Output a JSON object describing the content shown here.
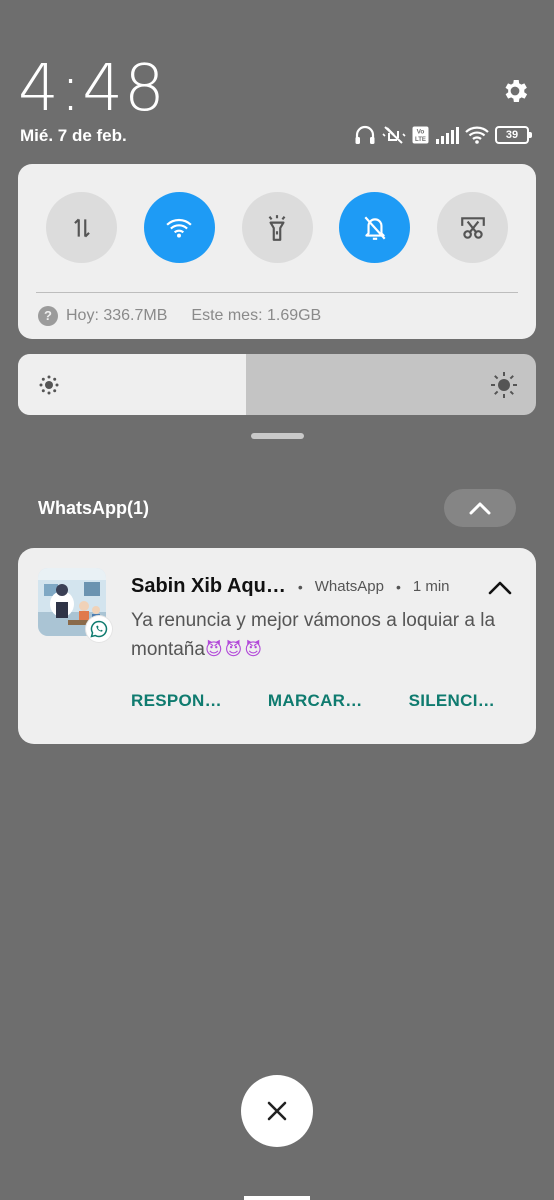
{
  "status": {
    "time": "4:48",
    "date": "Mié. 7 de feb.",
    "battery": "39",
    "volte": "Vo LTE",
    "icons": [
      "headphones-icon",
      "mute-vibrate-icon",
      "volte-icon",
      "signal-icon",
      "wifi-icon",
      "battery-icon"
    ]
  },
  "settings_icon": "gear-icon",
  "quick_settings": {
    "tiles": [
      {
        "name": "mobile-data",
        "icon": "data-arrows-icon",
        "active": false
      },
      {
        "name": "wifi",
        "icon": "wifi-icon",
        "active": true
      },
      {
        "name": "flashlight",
        "icon": "flashlight-icon",
        "active": false
      },
      {
        "name": "silent",
        "icon": "bell-off-icon",
        "active": true
      },
      {
        "name": "screenshot",
        "icon": "scissors-icon",
        "active": false
      }
    ],
    "usage_today": "Hoy: 336.7MB",
    "usage_month": "Este mes: 1.69GB"
  },
  "brightness": {
    "level": 0.44
  },
  "group": {
    "title": "WhatsApp(1)"
  },
  "notification": {
    "sender": "Sabin Xib Aqu…",
    "app": "WhatsApp",
    "time": "1 min",
    "message": "Ya renuncia y mejor vámonos a loquiar a la montaña",
    "emoji": "😈😈😈",
    "actions": [
      "RESPON…",
      "MARCAR…",
      "SILENCI…"
    ]
  },
  "colors": {
    "background": "#6e6e6e",
    "active_tile": "#1e9bf5",
    "action_text": "#0f7b6f"
  }
}
